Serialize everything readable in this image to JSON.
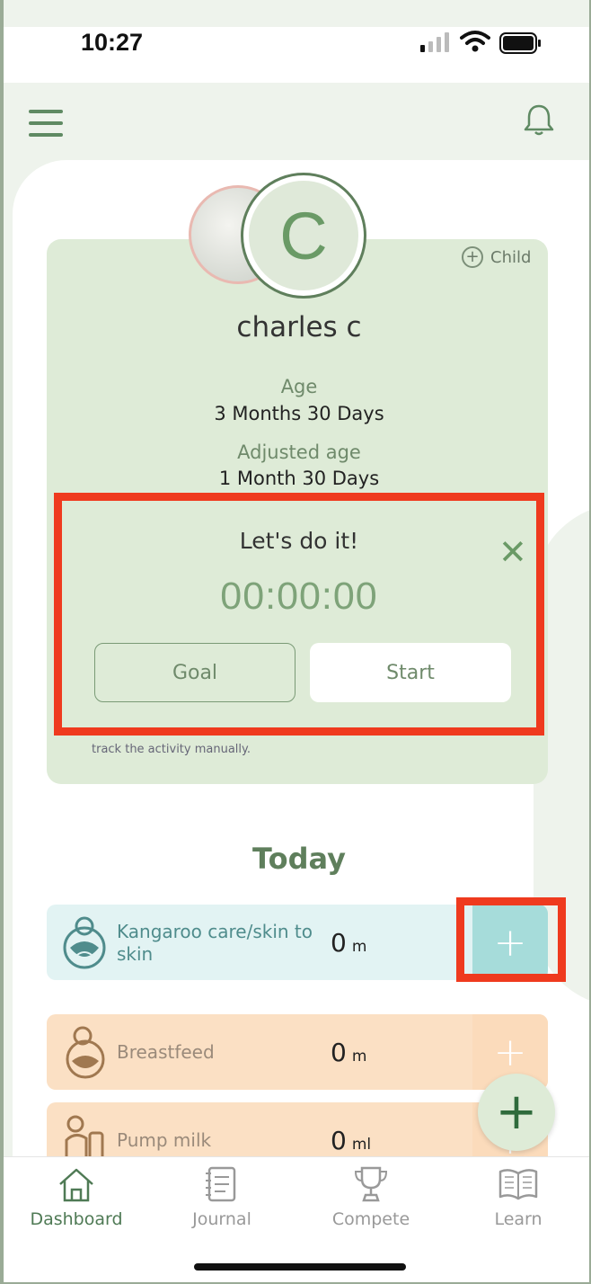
{
  "status_bar": {
    "time": "10:27"
  },
  "profile": {
    "initial": "C",
    "add_child_label": "Child",
    "name": "charles c",
    "age_label": "Age",
    "age_value": "3 Months 30 Days",
    "adjusted_age_label": "Adjusted age",
    "adjusted_age_value": "1 Month 30 Days",
    "note": "track the activity manually."
  },
  "timer": {
    "title": "Let's do it!",
    "value": "00:00:00",
    "goal_label": "Goal",
    "start_label": "Start"
  },
  "today": {
    "heading": "Today",
    "items": [
      {
        "label_line1": "Kangaroo care/skin to",
        "label_line2": "skin",
        "count": "0",
        "unit": "m",
        "icon": "kangaroo-care-icon"
      },
      {
        "label": "Breastfeed",
        "count": "0",
        "unit": "m",
        "icon": "breastfeed-icon"
      },
      {
        "label": "Pump milk",
        "count": "0",
        "unit": "ml",
        "icon": "pump-milk-icon"
      }
    ]
  },
  "tabs": [
    {
      "label": "Dashboard",
      "icon": "home-icon",
      "active": true
    },
    {
      "label": "Journal",
      "icon": "journal-icon",
      "active": false
    },
    {
      "label": "Compete",
      "icon": "trophy-icon",
      "active": false
    },
    {
      "label": "Learn",
      "icon": "book-icon",
      "active": false
    }
  ],
  "colors": {
    "accent": "#6a9a66",
    "highlight": "#ef3a1e",
    "kangaroo_bg": "#e2f3f3",
    "breastfeed_bg": "#fbe0c4"
  }
}
